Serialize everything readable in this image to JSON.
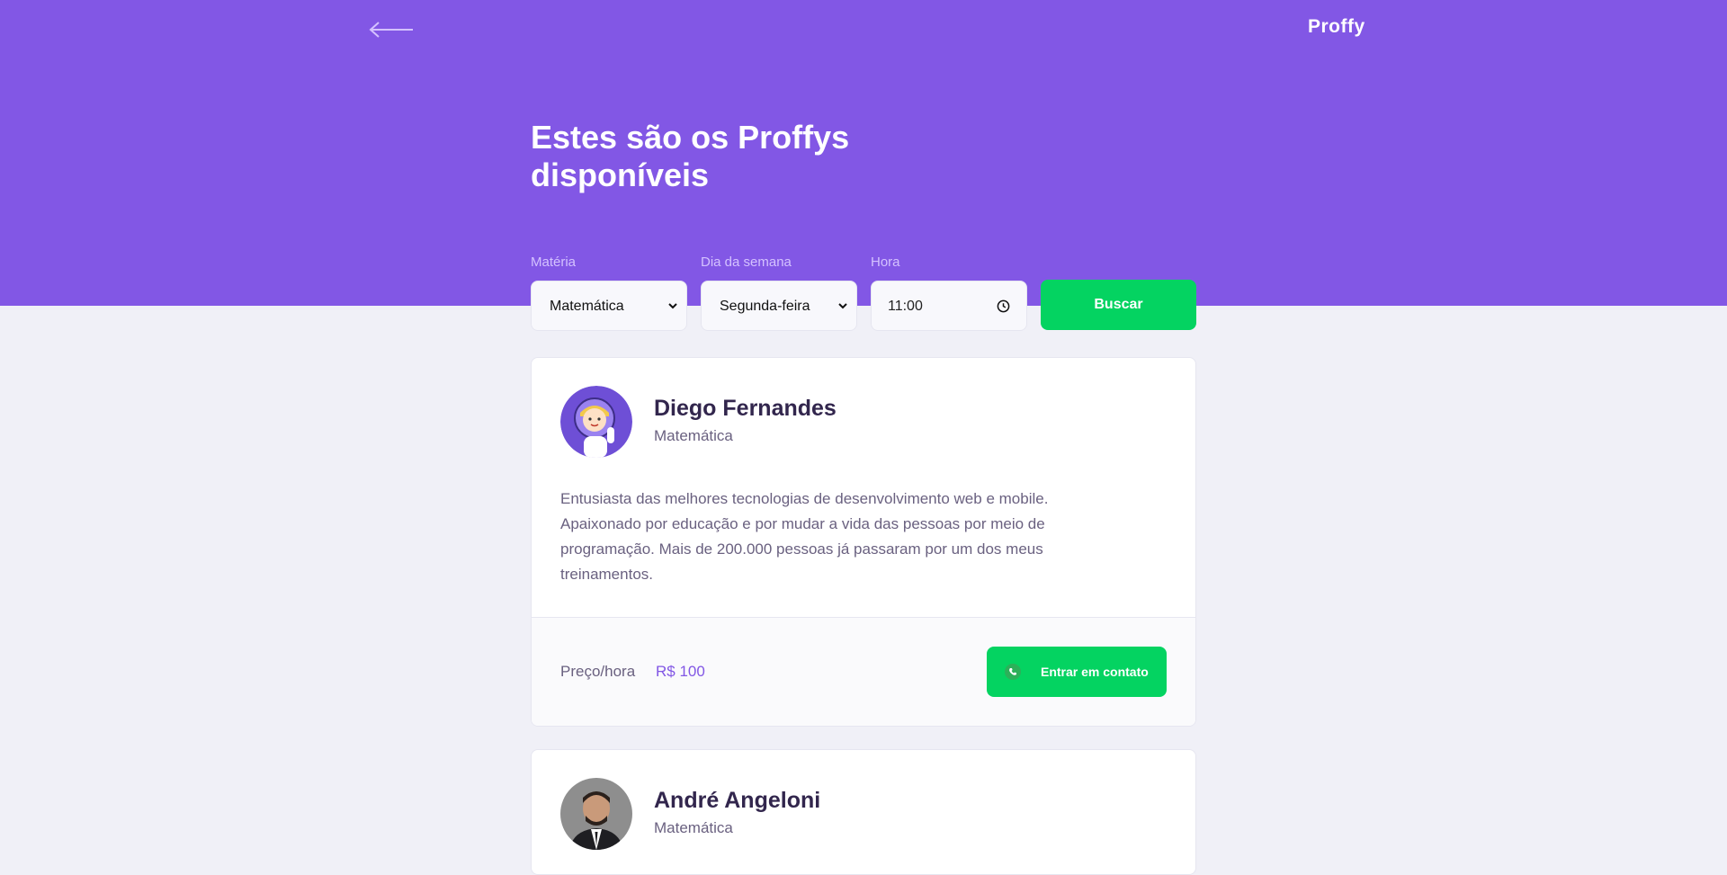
{
  "header": {
    "logo": "Proffy",
    "back_icon": "arrow-left-icon",
    "title": "Estes são os Proffys disponíveis"
  },
  "filters": {
    "subject": {
      "label": "Matéria",
      "value": "Matemática"
    },
    "weekday": {
      "label": "Dia da semana",
      "value": "Segunda-feira"
    },
    "time": {
      "label": "Hora",
      "value": "11:00"
    },
    "search_label": "Buscar"
  },
  "teachers": [
    {
      "name": "Diego Fernandes",
      "subject": "Matemática",
      "bio": "Entusiasta das melhores tecnologias de desenvolvimento web e mobile. Apaixonado por educação e por mudar a vida das pessoas por meio de programação. Mais de 200.000 pessoas já passaram por um dos meus treinamentos.",
      "price_label": "Preço/hora",
      "price": "R$ 100",
      "contact_label": "Entrar em contato"
    },
    {
      "name": "André Angeloni",
      "subject": "Matemática"
    }
  ],
  "colors": {
    "primary": "#8257E5",
    "background": "#F0F0F7",
    "green": "#04D361",
    "title_text": "#32264D",
    "body_text": "#6A6180"
  }
}
